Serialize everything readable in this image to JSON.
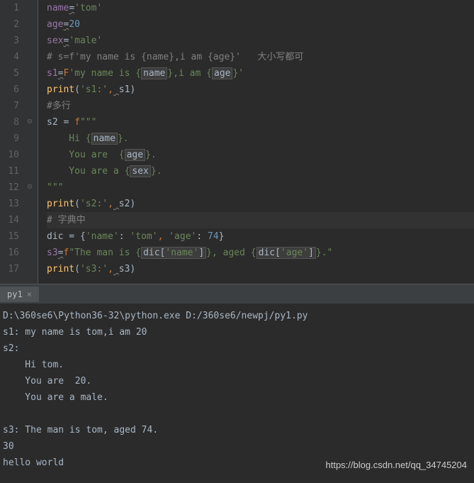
{
  "lines": [
    {
      "num": "1"
    },
    {
      "num": "2"
    },
    {
      "num": "3"
    },
    {
      "num": "4"
    },
    {
      "num": "5"
    },
    {
      "num": "6"
    },
    {
      "num": "7"
    },
    {
      "num": "8"
    },
    {
      "num": "9"
    },
    {
      "num": "10"
    },
    {
      "num": "11"
    },
    {
      "num": "12"
    },
    {
      "num": "13"
    },
    {
      "num": "14"
    },
    {
      "num": "15"
    },
    {
      "num": "16"
    },
    {
      "num": "17"
    }
  ],
  "code": {
    "l1": {
      "var": "name",
      "eq": "=",
      "val": "'tom'"
    },
    "l2": {
      "var": "age",
      "eq": "=",
      "val": "20"
    },
    "l3": {
      "var": "sex",
      "eq": "=",
      "val": "'male'"
    },
    "l4": {
      "comment": "# s=f'my name is {name},i am {age}'   大小写都可"
    },
    "l5": {
      "var": "s1",
      "eq": "=",
      "pre": "F",
      "s1": "'my name is {",
      "b1": "name",
      "s2": "},i am {",
      "b2": "age",
      "s3": "}'"
    },
    "l6": {
      "fn": "print",
      "p1": "(",
      "s": "'s1:'",
      "c": ",",
      "sp": " ",
      "v": "s1",
      "p2": ")"
    },
    "l7": {
      "comment": "#多行"
    },
    "l8": {
      "var": "s2 = ",
      "pre": "f",
      "q": "\"\"\""
    },
    "l9": {
      "s1": "    Hi {",
      "b": "name",
      "s2": "}."
    },
    "l10": {
      "s1": "    You are  {",
      "b": "age",
      "s2": "}."
    },
    "l11": {
      "s1": "    You are a {",
      "b": "sex",
      "s2": "}."
    },
    "l12": {
      "q": "\"\"\""
    },
    "l13": {
      "fn": "print",
      "p1": "(",
      "s": "'s2:'",
      "c": ",",
      "sp": " ",
      "v": "s2",
      "p2": ")"
    },
    "l14": {
      "comment": "# 字典中"
    },
    "l15": {
      "var": "dic = ",
      "b1": "{",
      "k1": "'name'",
      "c1": ": ",
      "v1": "'tom'",
      "cm": ", ",
      "k2": "'age'",
      "c2": ": ",
      "v2": "74",
      "b2": "}"
    },
    "l16": {
      "var": "s3",
      "eq": "=",
      "pre": "f",
      "s1": "\"The man is {",
      "d1": "dic[",
      "k1": "'name'",
      "d1e": "]",
      "s2": "}, aged {",
      "d2": "dic[",
      "k2": "'age'",
      "d2e": "]",
      "s3": "}.\""
    },
    "l17": {
      "fn": "print",
      "p1": "(",
      "s": "'s3:'",
      "c": ",",
      "sp": " ",
      "v": "s3",
      "p2": ")"
    }
  },
  "tab": {
    "name": "py1",
    "close": "×"
  },
  "console": {
    "l1": "D:\\360se6\\Python36-32\\python.exe D:/360se6/newpj/py1.py",
    "l2": "s1: my name is tom,i am 20",
    "l3": "s2:",
    "l4": "    Hi tom.",
    "l5": "    You are  20.",
    "l6": "    You are a male.",
    "l7": "",
    "l8": "s3: The man is tom, aged 74.",
    "l9": "30",
    "l10": "hello world"
  },
  "watermark": "https://blog.csdn.net/qq_34745204"
}
